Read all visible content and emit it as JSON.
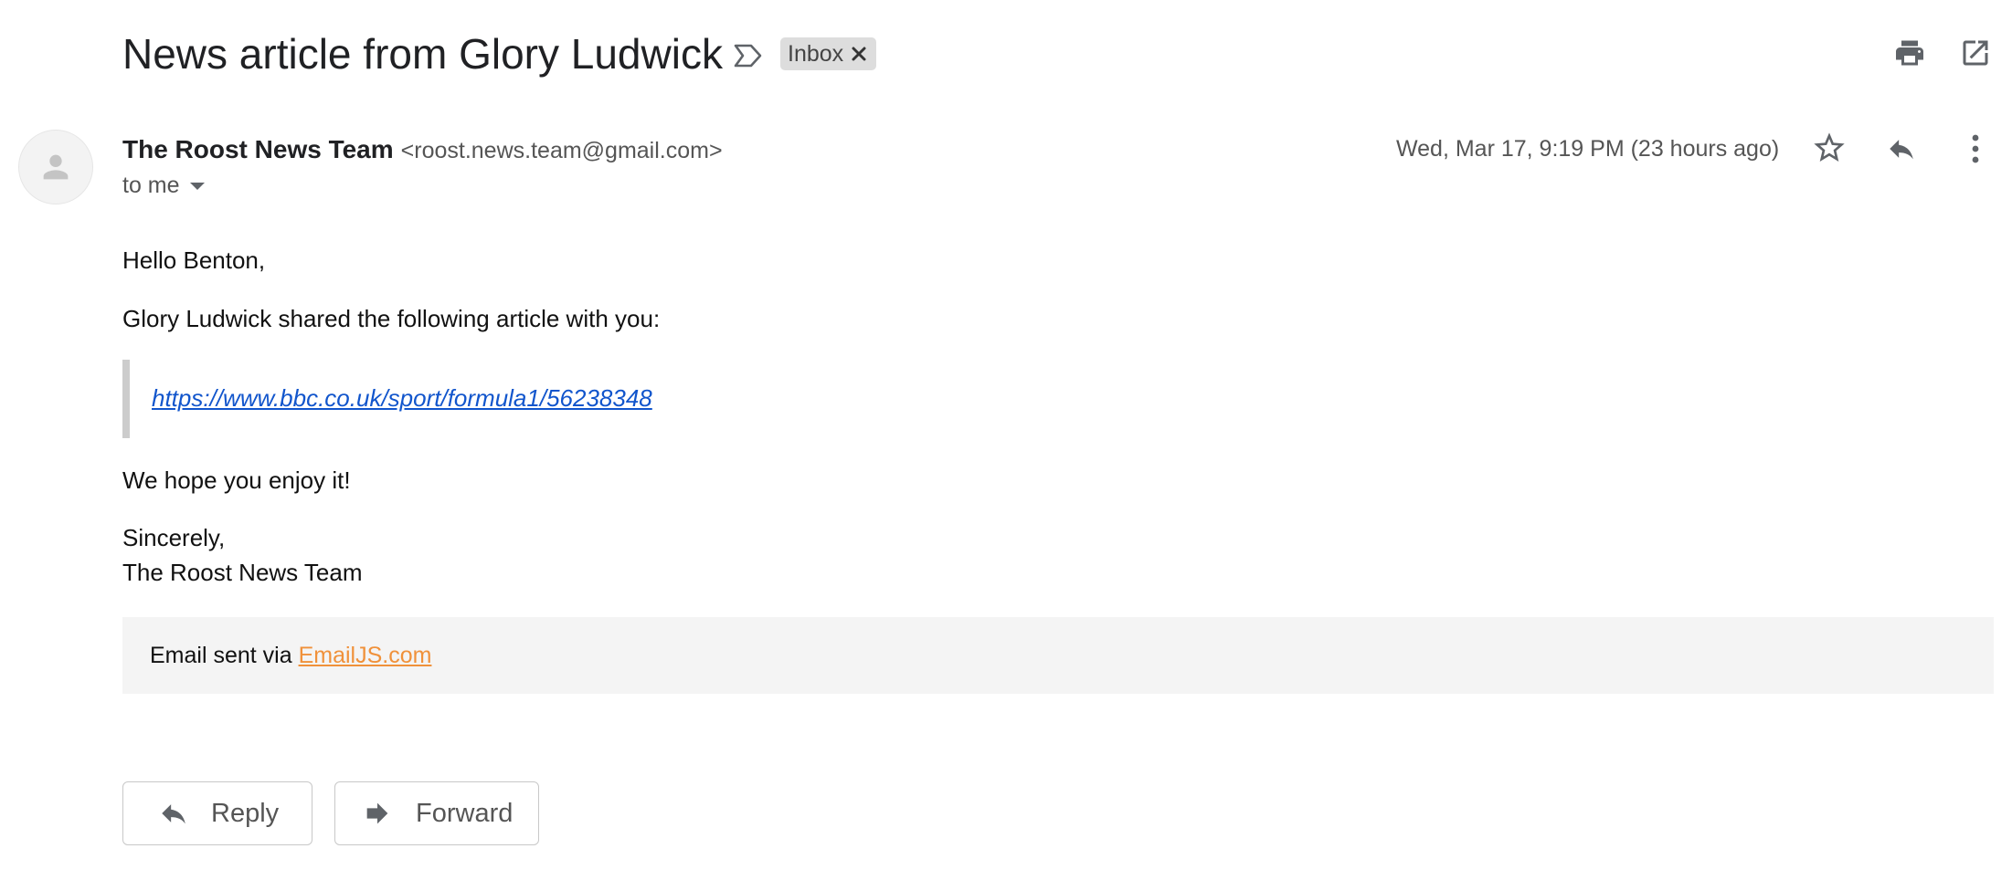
{
  "header": {
    "subject": "News article from Glory Ludwick",
    "label_chip": "Inbox",
    "icons": [
      "label-icon",
      "close-icon",
      "print-icon",
      "open-in-new-window-icon"
    ]
  },
  "message": {
    "sender_name": "The Roost News Team",
    "sender_email": "<roost.news.team@gmail.com>",
    "recipient": "to me",
    "date": "Wed, Mar 17, 9:19 PM (23 hours ago)",
    "icons": [
      "avatar-person-icon",
      "chevron-down-icon",
      "star-icon",
      "reply-icon",
      "more-vert-icon"
    ]
  },
  "body": {
    "greeting": "Hello Benton,",
    "shared": "Glory Ludwick shared the following article with you:",
    "article_url": "https://www.bbc.co.uk/sport/formula1/56238348",
    "enjoy": "We hope you enjoy it!",
    "sign_off": "Sincerely,",
    "signature": "The Roost News Team",
    "footer_prefix": "Email sent via ",
    "footer_link": "EmailJS.com"
  },
  "actions": {
    "reply_label": "Reply",
    "forward_label": "Forward"
  },
  "colors": {
    "link": "#1155cc",
    "footer_link": "#f0913a",
    "chip_bg": "#dddddd",
    "footer_bg": "#f4f4f4",
    "icon": "#5f6368"
  }
}
